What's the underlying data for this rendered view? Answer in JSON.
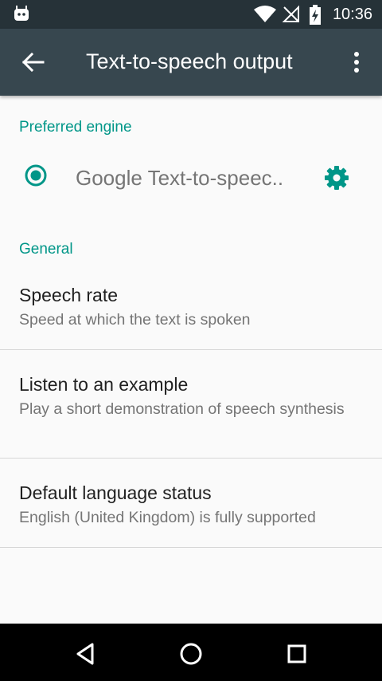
{
  "status_bar": {
    "time": "10:36",
    "icons": [
      "android-debug-icon",
      "wifi-icon",
      "no-signal-icon",
      "battery-charging-icon"
    ]
  },
  "toolbar": {
    "title": "Text-to-speech output",
    "back_icon": "arrow-back-icon",
    "menu_icon": "more-vert-icon"
  },
  "preferred_engine": {
    "header": "Preferred engine",
    "engine_label": "Google Text-to-speec..",
    "selected": true,
    "settings_icon": "gear-icon"
  },
  "general": {
    "header": "General",
    "items": [
      {
        "title": "Speech rate",
        "summary": "Speed at which the text is spoken"
      },
      {
        "title": "Listen to an example",
        "summary": "Play a short demonstration of speech synthesis"
      },
      {
        "title": "Default language status",
        "summary": "English (United Kingdom) is fully supported"
      }
    ]
  },
  "nav_bar": {
    "icons": [
      "back-triangle-icon",
      "home-circle-icon",
      "recents-square-icon"
    ]
  },
  "colors": {
    "accent": "#009688",
    "toolbar": "#37474f",
    "status_bar": "#263238",
    "background": "#fafafa"
  }
}
